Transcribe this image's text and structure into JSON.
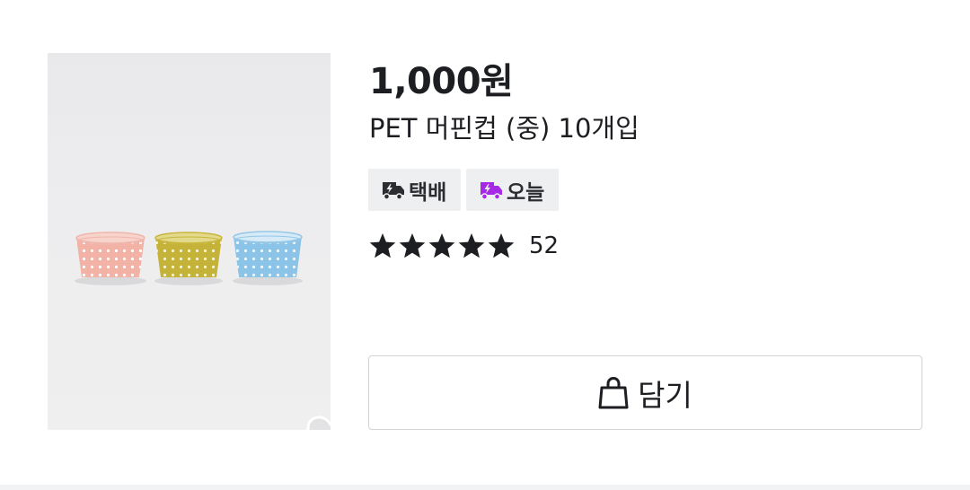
{
  "product": {
    "price": "1,000원",
    "title": "PET 머핀컵 (중) 10개입",
    "image_icon": "product-photo-muffin-cups",
    "wishlist_icon": "heart-icon"
  },
  "badges": [
    {
      "label": "택배",
      "icon": "delivery-truck-icon",
      "icon_color": "#2b2d31"
    },
    {
      "label": "오늘",
      "icon": "same-day-delivery-icon",
      "icon_color": "#a629e6"
    }
  ],
  "rating": {
    "stars": 5,
    "count": "52",
    "star_color": "#1c1e22"
  },
  "cart_button": {
    "label": "담기",
    "icon": "shopping-bag-icon"
  },
  "colors": {
    "text": "#1c1e22",
    "badge_bg": "#eeeff1",
    "button_border": "#d2d4d8",
    "accent_purple": "#a629e6"
  }
}
